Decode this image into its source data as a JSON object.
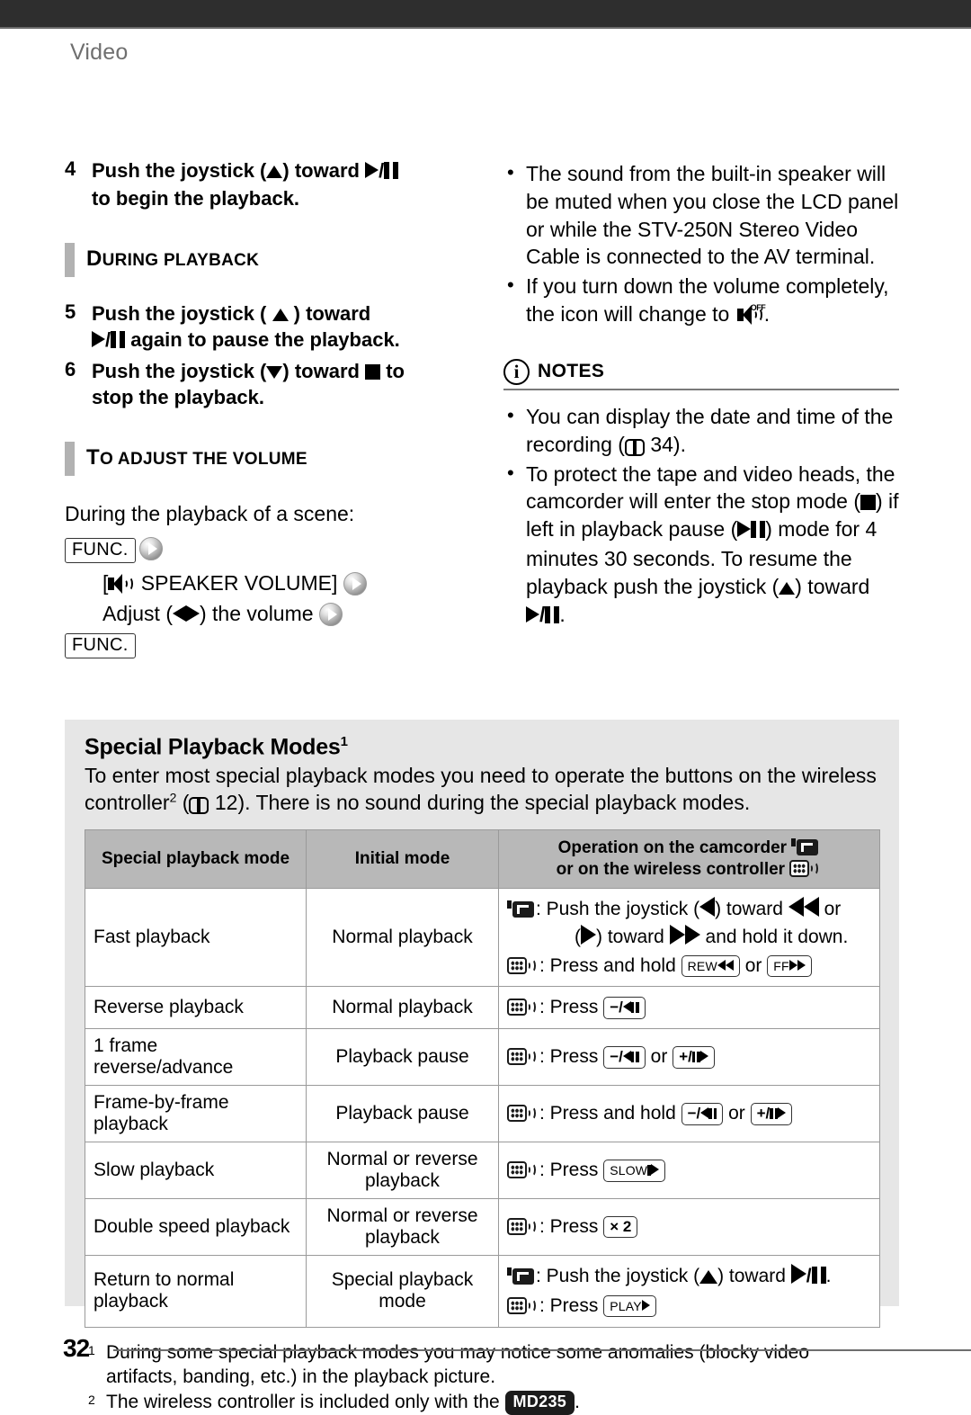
{
  "page": {
    "running_head": "Video",
    "page_number": "32"
  },
  "steps": [
    {
      "num": "4",
      "line1_a": "Push the joystick (",
      "line1_b": ") toward ",
      "line2": "to begin the playback."
    },
    {
      "num": "5",
      "line1_a": "Push the joystick (",
      "line1_b": ") toward",
      "line2": "again to pause the playback."
    },
    {
      "num": "6",
      "line1_a": "Push the joystick (",
      "line1_b": ") toward ",
      "line1_c": "to",
      "line2": "stop the playback."
    }
  ],
  "sections": {
    "during_playback": {
      "first": "D",
      "rest": "URING PLAYBACK"
    },
    "to_adjust_volume": {
      "first": "T",
      "rest": "O ADJUST THE VOLUME"
    }
  },
  "volume": {
    "intro": "During the playback of a scene:",
    "func_label": "FUNC.",
    "menu_item": "SPEAKER VOLUME]",
    "menu_bracket_open": "[",
    "adjust_a": "Adjust (",
    "adjust_b": ") the volume",
    "func_label_end": "FUNC."
  },
  "right_bullets": [
    "The sound from the built-in speaker will be muted when you close the LCD panel or while the STV-250N Stereo Video Cable is connected to the AV terminal.",
    "If you turn down the volume completely, the icon will change to"
  ],
  "notes": {
    "title": "NOTES",
    "info_glyph": "i",
    "items": [
      {
        "text_a": "You can display the date and time of the recording (",
        "page_ref": "34",
        "text_b": ")."
      },
      {
        "text_a": "To protect the tape and video heads, the camcorder will enter the stop mode (",
        "text_b": ") if left in playback pause (",
        "text_c": ") mode for 4 minutes 30 seconds. To resume the playback push the joystick (",
        "text_d": ") toward"
      }
    ]
  },
  "special": {
    "title": "Special Playback Modes",
    "title_sup": "1",
    "intro_a": "To enter most special playback modes you need to operate the buttons on the wireless controller",
    "intro_sup": "2",
    "intro_page_ref": "12",
    "intro_b": "). There is no sound during the special playback modes."
  },
  "table": {
    "headers": {
      "col1": "Special playback mode",
      "col2": "Initial mode",
      "col3_line1": "Operation on the camcorder",
      "col3_line2": "or on the wireless controller"
    },
    "rows": [
      {
        "mode": "Fast playback",
        "initial": "Normal playback",
        "ops": [
          {
            "device": "camcorder",
            "pre": ": Push the joystick (",
            "mid": ") toward ",
            "post": " or"
          },
          {
            "device": "none",
            "pre": "(",
            "mid": ") toward ",
            "post": " and hold it down."
          },
          {
            "device": "remote",
            "pre": ": Press and hold ",
            "keys": [
              "REW",
              "FF"
            ],
            "joiner": " or "
          }
        ]
      },
      {
        "mode": "Reverse playback",
        "initial": "Normal playback",
        "ops": [
          {
            "device": "remote",
            "pre": ": Press ",
            "keys": [
              "minus-rev"
            ]
          }
        ]
      },
      {
        "mode": "1 frame reverse/advance",
        "initial": "Playback pause",
        "ops": [
          {
            "device": "remote",
            "pre": ": Press ",
            "keys": [
              "minus-rev",
              "plus-adv"
            ],
            "joiner": " or "
          }
        ]
      },
      {
        "mode": "Frame-by-frame playback",
        "initial": "Playback pause",
        "ops": [
          {
            "device": "remote",
            "pre": ": Press and hold ",
            "keys": [
              "minus-rev",
              "plus-adv"
            ],
            "joiner": " or "
          }
        ]
      },
      {
        "mode": "Slow playback",
        "initial": "Normal or reverse playback",
        "ops": [
          {
            "device": "remote",
            "pre": ": Press ",
            "keys": [
              "SLOW"
            ]
          }
        ]
      },
      {
        "mode": "Double speed playback",
        "initial": "Normal or reverse playback",
        "ops": [
          {
            "device": "remote",
            "pre": ": Press ",
            "keys": [
              "x2"
            ]
          }
        ]
      },
      {
        "mode": "Return to normal playback",
        "initial": "Special playback mode",
        "ops": [
          {
            "device": "camcorder",
            "pre": ": Push the joystick (",
            "mid": ") toward ",
            "post": "."
          },
          {
            "device": "remote",
            "pre": ": Press ",
            "keys": [
              "PLAY"
            ]
          }
        ]
      }
    ],
    "key_labels": {
      "rew": "REW",
      "ff": "FF",
      "minus": "−/",
      "plus": "+/",
      "slow": "SLOW",
      "x2": "× 2",
      "play": "PLAY"
    }
  },
  "footnotes": [
    {
      "marker": "1",
      "text": "During some special playback modes you may notice some anomalies (blocky video artifacts, banding, etc.) in the playback picture."
    },
    {
      "marker": "2",
      "text_a": "The wireless controller is included only with the ",
      "badge": "MD235",
      "text_b": "."
    }
  ],
  "colors": {
    "topbar": "#2e2e2e",
    "panel": "#e6e6e6",
    "table_header": "#b8b8b8",
    "accent_bar": "#b2b2b2",
    "running_head": "#6f6f6f"
  }
}
